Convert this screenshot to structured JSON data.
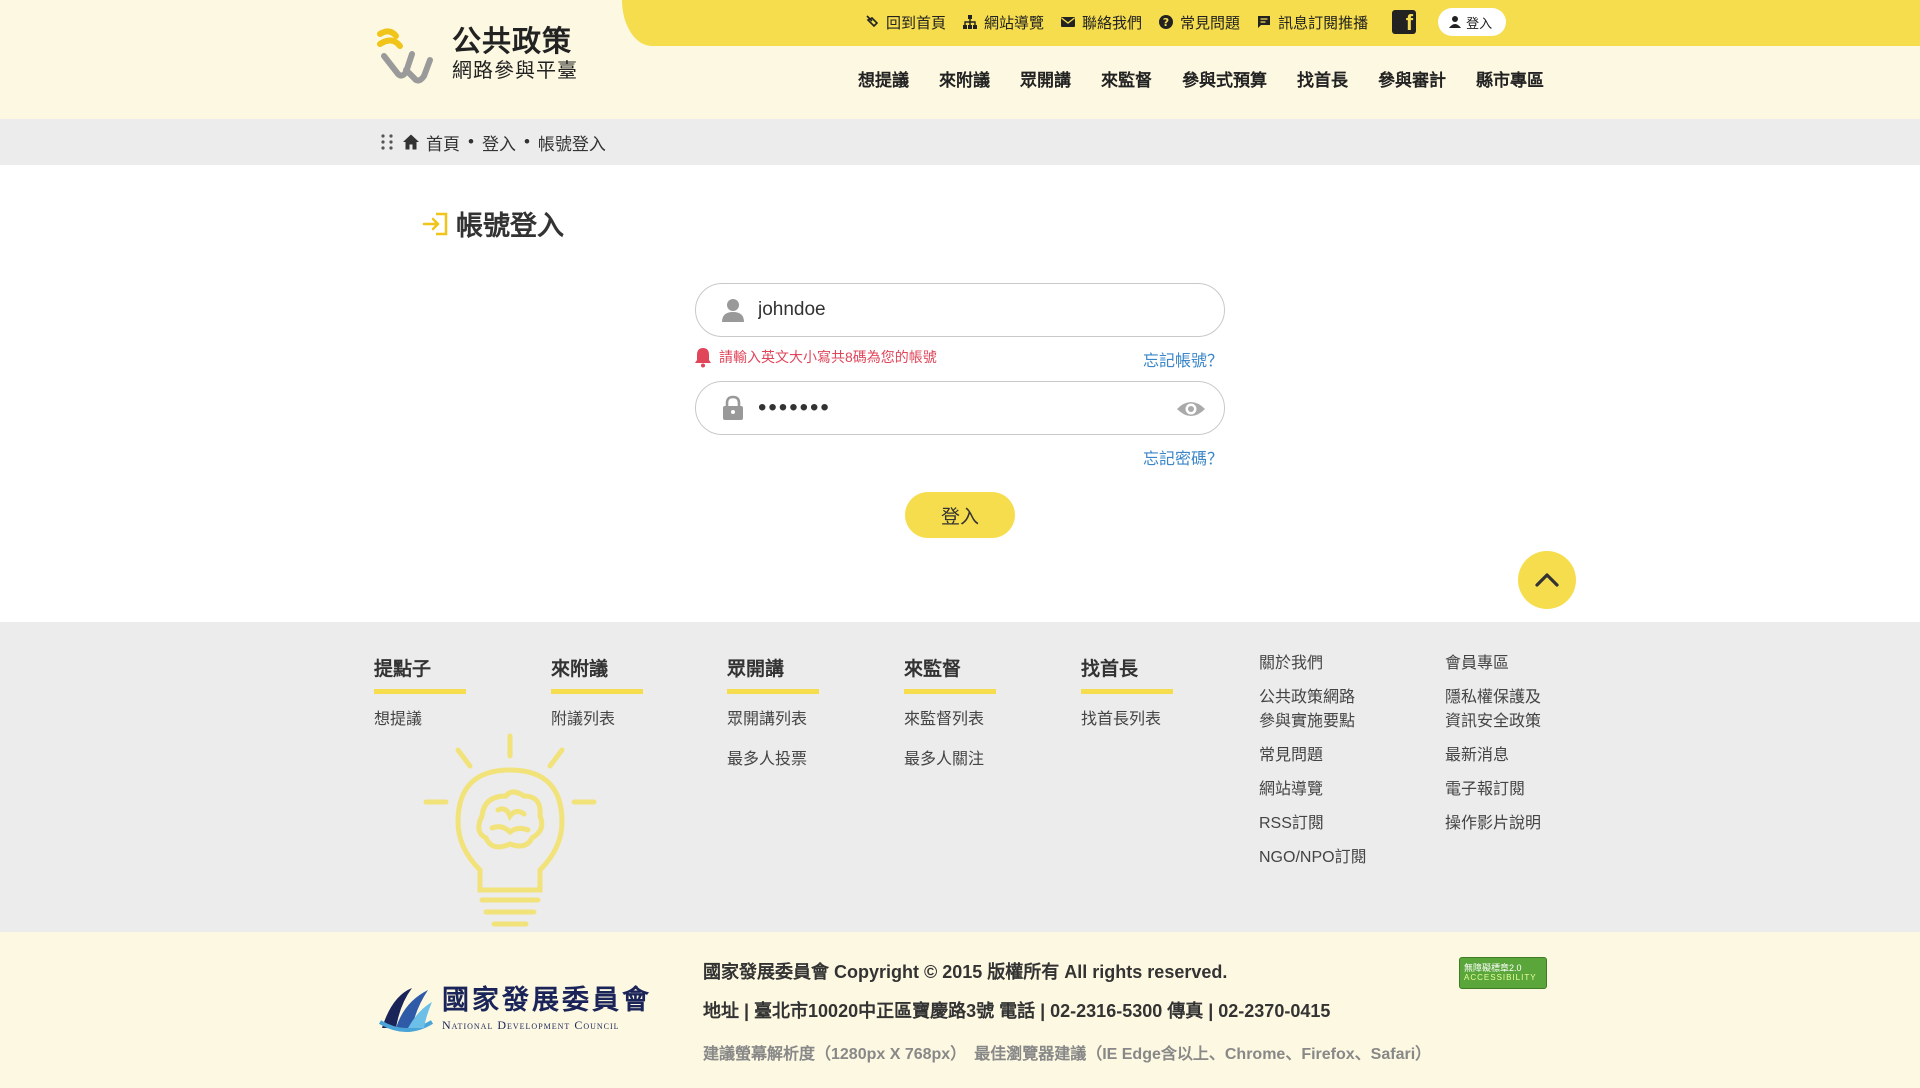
{
  "header": {
    "logo_title": "公共政策",
    "logo_subtitle": "網路參與平臺",
    "util_links": {
      "home": "回到首頁",
      "sitemap": "網站導覽",
      "contact": "聯絡我們",
      "faq": "常見問題",
      "subscribe": "訊息訂閱推播"
    },
    "login_label": "登入",
    "nav": [
      "想提議",
      "來附議",
      "眾開講",
      "來監督",
      "參與式預算",
      "找首長",
      "參與審計",
      "縣市專區"
    ]
  },
  "breadcrumb": {
    "home": "首頁",
    "level1": "登入",
    "level2": "帳號登入"
  },
  "main": {
    "title": "帳號登入",
    "username_value": "johndoe",
    "username_hint": "請輸入英文大小寫共8碼為您的帳號",
    "forgot_account": "忘記帳號？",
    "password_value": "•••••••",
    "forgot_password": "忘記密碼？",
    "submit_label": "登入"
  },
  "footer_nav": {
    "col1": {
      "title": "提點子",
      "links": [
        "想提議"
      ]
    },
    "col2": {
      "title": "來附議",
      "links": [
        "附議列表"
      ]
    },
    "col3": {
      "title": "眾開講",
      "links": [
        "眾開講列表",
        "最多人投票"
      ]
    },
    "col4": {
      "title": "來監督",
      "links": [
        "來監督列表",
        "最多人關注"
      ]
    },
    "col5": {
      "title": "找首長",
      "links": [
        "找首長列表"
      ]
    },
    "col6": {
      "links": [
        "關於我們",
        "公共政策網路\n參與實施要點",
        "常見問題",
        "網站導覽",
        "RSS訂閱",
        "NGO/NPO訂閱"
      ]
    },
    "col7": {
      "links": [
        "會員專區",
        "隱私權保護及\n資訊安全政策",
        "最新消息",
        "電子報訂閱",
        "操作影片說明"
      ]
    }
  },
  "footer_bottom": {
    "org_cn": "國家發展委員會",
    "org_en": "National Development Council",
    "copyright": "國家發展委員會 Copyright © 2015 版權所有 All rights reserved.",
    "address": "地址 | 臺北市10020中正區寶慶路3號 電話 | 02-2316-5300 傳真 | 02-2370-0415",
    "recommend": "建議螢幕解析度（1280px X 768px）　最佳瀏覽器建議（IE Edge含以上、Chrome、Firefox、Safari）",
    "badge_line1": "無障礙標章2.0",
    "badge_line2": "ACCESSIBILITY"
  },
  "colors": {
    "accent": "#f5dd4d",
    "header_bg": "#fdf8e1",
    "link": "#3a86c8",
    "error": "#e0455a"
  }
}
